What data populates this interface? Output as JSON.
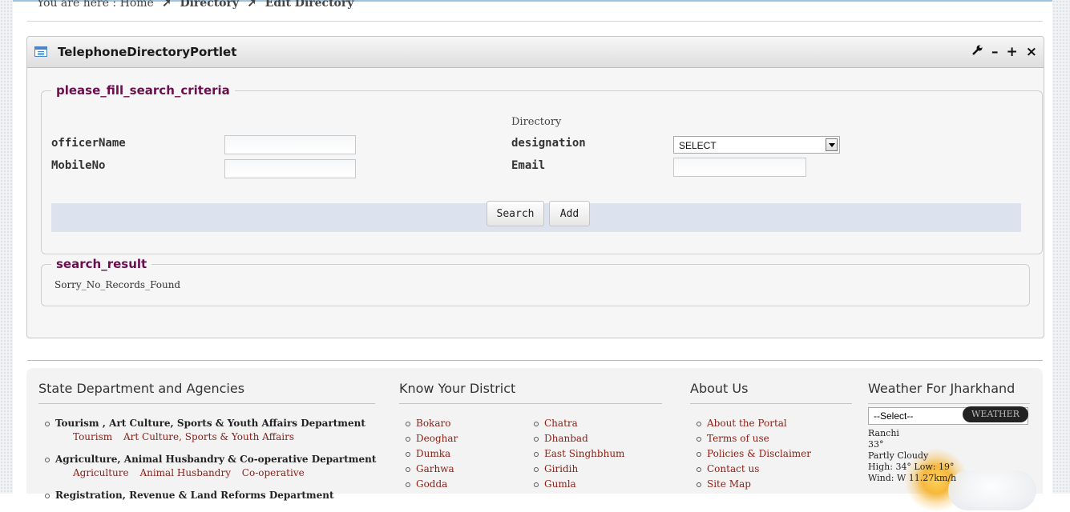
{
  "breadcrumb": {
    "prefix": "You are here :",
    "home": "Home",
    "directory": "Directory",
    "current": "Edit Directory"
  },
  "portlet": {
    "title": "TelephoneDirectoryPortlet",
    "icons": [
      "portlet-icon",
      "wrench-icon",
      "minimize-icon",
      "maximize-icon",
      "close-icon"
    ],
    "controls": {
      "config": "⚙",
      "minimize": "–",
      "maximize": "+",
      "close": "×"
    }
  },
  "search_form": {
    "legend": "please_fill_search_criteria",
    "section_label": "Directory",
    "officer_name_label": "officerName",
    "mobile_label": "MobileNo",
    "designation_label": "designation",
    "email_label": "Email",
    "designation_selected": "SELECT",
    "officer_name_value": "",
    "mobile_value": "",
    "email_value": "",
    "search_button": "Search",
    "add_button": "Add"
  },
  "search_result": {
    "legend": "search_result",
    "message": "Sorry_No_Records_Found"
  },
  "footer": {
    "departments": {
      "heading": "State Department and Agencies",
      "items": [
        {
          "name": "Tourism , Art Culture, Sports & Youth Affairs Department",
          "subs": [
            "Tourism",
            "Art Culture, Sports & Youth Affairs"
          ]
        },
        {
          "name": "Agriculture, Animal Husbandry & Co-operative Department",
          "subs": [
            "Agriculture",
            "Animal Husbandry",
            "Co-operative"
          ]
        },
        {
          "name": "Registration, Revenue & Land Reforms Department",
          "subs": []
        }
      ]
    },
    "districts": {
      "heading": "Know Your District",
      "col1": [
        "Bokaro",
        "Deoghar",
        "Dumka",
        "Garhwa",
        "Godda"
      ],
      "col2": [
        "Chatra",
        "Dhanbad",
        "East Singhbhum",
        "Giridih",
        "Gumla"
      ]
    },
    "about": {
      "heading": "About Us",
      "items": [
        "About the Portal",
        "Terms of use",
        "Policies & Disclaimer",
        "Contact us",
        "Site Map"
      ]
    },
    "weather": {
      "heading": "Weather For Jharkhand",
      "select_value": "--Select--",
      "button": "WEATHER",
      "city": "Ranchi",
      "temp": "33°",
      "condition": "Partly Cloudy",
      "high_low": "High: 34° Low: 19°",
      "wind": "Wind: W 11.27km/h"
    }
  }
}
